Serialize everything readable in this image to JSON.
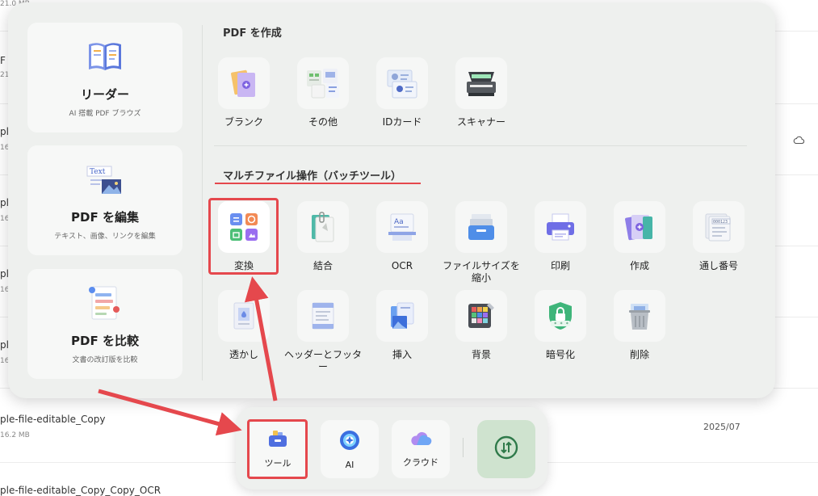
{
  "background_files": [
    {
      "name": "",
      "size": "21.0 MB",
      "date": ""
    },
    {
      "name": "F",
      "size": "21.",
      "date": ""
    },
    {
      "name": "ple",
      "size": "16",
      "date": ""
    },
    {
      "name": "ple",
      "size": "16",
      "date": ""
    },
    {
      "name": "ple",
      "size": "16",
      "date": ""
    },
    {
      "name": "ple",
      "size": "16",
      "date": ""
    },
    {
      "name": "ple-file-editable_Copy",
      "size": "16.2 MB",
      "date": "2025/07"
    },
    {
      "name": "ple-file-editable_Copy_Copy_OCR",
      "size": "",
      "date": ""
    }
  ],
  "left_cards": [
    {
      "title": "リーダー",
      "subtitle": "AI 搭載 PDF ブラウズ"
    },
    {
      "title": "PDF を編集",
      "subtitle": "テキスト、画像、リンクを編集",
      "icon_text": "Text"
    },
    {
      "title": "PDF を比較",
      "subtitle": "文書の改訂版を比較"
    }
  ],
  "create_section": {
    "title": "PDF を作成",
    "tools": [
      {
        "label": "ブランク",
        "icon": "blank-page-icon"
      },
      {
        "label": "その他",
        "icon": "other-docs-icon"
      },
      {
        "label": "IDカード",
        "icon": "id-card-icon"
      },
      {
        "label": "スキャナー",
        "icon": "scanner-icon"
      }
    ]
  },
  "batch_section": {
    "title": "マルチファイル操作（バッチツール）",
    "tools": [
      {
        "label": "変換",
        "icon": "convert-icon"
      },
      {
        "label": "結合",
        "icon": "merge-icon"
      },
      {
        "label": "OCR",
        "icon": "ocr-icon"
      },
      {
        "label": "ファイルサイズを縮小",
        "icon": "compress-icon"
      },
      {
        "label": "印刷",
        "icon": "print-icon"
      },
      {
        "label": "作成",
        "icon": "create-icon"
      },
      {
        "label": "通し番号",
        "icon": "bates-number-icon"
      },
      {
        "label": "透かし",
        "icon": "watermark-icon"
      },
      {
        "label": "ヘッダーとフッター",
        "icon": "header-footer-icon"
      },
      {
        "label": "挿入",
        "icon": "insert-icon"
      },
      {
        "label": "背景",
        "icon": "background-icon"
      },
      {
        "label": "暗号化",
        "icon": "encrypt-icon"
      },
      {
        "label": "削除",
        "icon": "delete-icon"
      }
    ]
  },
  "dock": {
    "tools_label": "ツール",
    "ai_label": "AI",
    "cloud_label": "クラウド"
  },
  "colors": {
    "highlight": "#e5484d",
    "panel": "#eef0ee",
    "refresh_bg": "#cfe3cf"
  }
}
